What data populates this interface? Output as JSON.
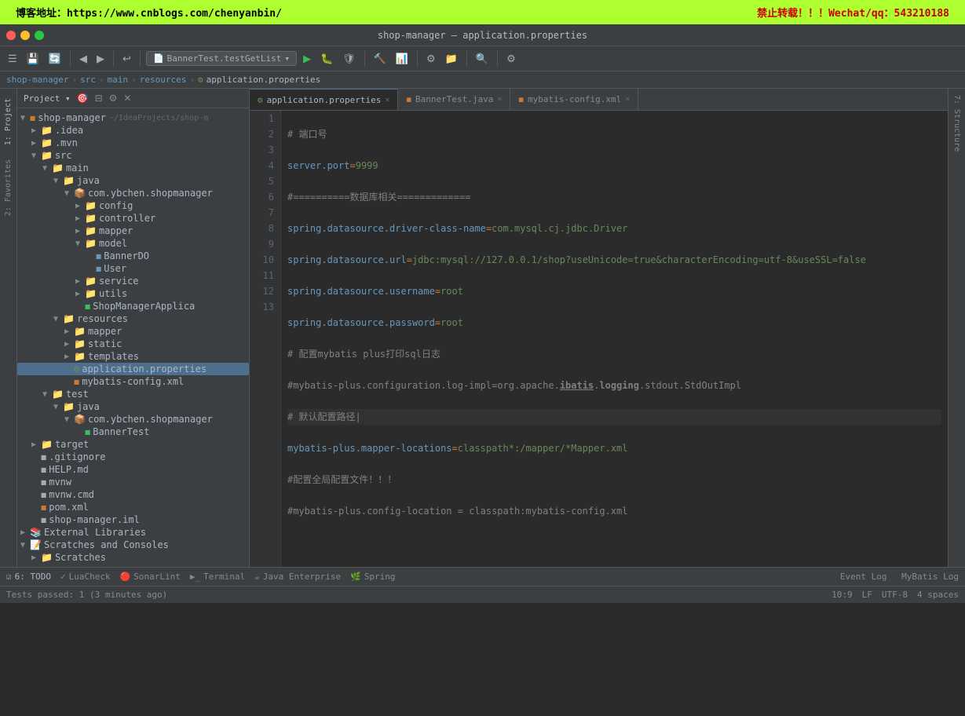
{
  "banner": {
    "left": "博客地址：https://www.cnblogs.com/chenyanbin/",
    "right": "禁止转载！！！Wechat/qq：543210188"
  },
  "titlebar": {
    "title": "shop-manager – application.properties"
  },
  "toolbar": {
    "run_config": "BannerTest.testGetList",
    "run_config_dropdown": "▾"
  },
  "breadcrumb": {
    "items": [
      "shop-manager",
      "src",
      "main",
      "resources",
      "application.properties"
    ]
  },
  "tabs": [
    {
      "label": "application.properties",
      "icon": "props",
      "active": true
    },
    {
      "label": "BannerTest.java",
      "icon": "java",
      "active": false
    },
    {
      "label": "mybatis-config.xml",
      "icon": "xml",
      "active": false
    }
  ],
  "sidebar": {
    "title": "Project",
    "tree": [
      {
        "label": "shop-manager",
        "type": "module",
        "level": 0,
        "expanded": true,
        "suffix": "~/IdeaProjects/shop-m"
      },
      {
        "label": ".idea",
        "type": "folder",
        "level": 1,
        "expanded": false
      },
      {
        "label": ".mvn",
        "type": "folder",
        "level": 1,
        "expanded": false
      },
      {
        "label": "src",
        "type": "folder",
        "level": 1,
        "expanded": true
      },
      {
        "label": "main",
        "type": "folder",
        "level": 2,
        "expanded": true
      },
      {
        "label": "java",
        "type": "folder",
        "level": 3,
        "expanded": true
      },
      {
        "label": "com.ybchen.shopmanager",
        "type": "package",
        "level": 4,
        "expanded": true
      },
      {
        "label": "config",
        "type": "folder",
        "level": 5,
        "expanded": false
      },
      {
        "label": "controller",
        "type": "folder",
        "level": 5,
        "expanded": false
      },
      {
        "label": "mapper",
        "type": "folder",
        "level": 5,
        "expanded": false
      },
      {
        "label": "model",
        "type": "folder",
        "level": 5,
        "expanded": true
      },
      {
        "label": "BannerDO",
        "type": "class",
        "level": 6,
        "expanded": false
      },
      {
        "label": "User",
        "type": "class",
        "level": 6,
        "expanded": false
      },
      {
        "label": "service",
        "type": "folder",
        "level": 5,
        "expanded": false
      },
      {
        "label": "utils",
        "type": "folder",
        "level": 5,
        "expanded": false
      },
      {
        "label": "ShopManagerApplica",
        "type": "appclass",
        "level": 5,
        "expanded": false
      },
      {
        "label": "resources",
        "type": "folder",
        "level": 3,
        "expanded": true
      },
      {
        "label": "mapper",
        "type": "folder",
        "level": 4,
        "expanded": false
      },
      {
        "label": "static",
        "type": "folder",
        "level": 4,
        "expanded": false
      },
      {
        "label": "templates",
        "type": "folder",
        "level": 4,
        "expanded": false
      },
      {
        "label": "application.properties",
        "type": "properties",
        "level": 4,
        "expanded": false,
        "selected": true
      },
      {
        "label": "mybatis-config.xml",
        "type": "xml",
        "level": 4,
        "expanded": false
      },
      {
        "label": "test",
        "type": "folder",
        "level": 2,
        "expanded": true
      },
      {
        "label": "java",
        "type": "folder",
        "level": 3,
        "expanded": true
      },
      {
        "label": "com.ybchen.shopmanager",
        "type": "package",
        "level": 4,
        "expanded": true
      },
      {
        "label": "BannerTest",
        "type": "testclass",
        "level": 5,
        "expanded": false
      },
      {
        "label": "target",
        "type": "folder",
        "level": 1,
        "expanded": false
      },
      {
        "label": ".gitignore",
        "type": "git",
        "level": 1
      },
      {
        "label": "HELP.md",
        "type": "md",
        "level": 1
      },
      {
        "label": "mvnw",
        "type": "file",
        "level": 1
      },
      {
        "label": "mvnw.cmd",
        "type": "file",
        "level": 1
      },
      {
        "label": "pom.xml",
        "type": "xml",
        "level": 1
      },
      {
        "label": "shop-manager.iml",
        "type": "iml",
        "level": 1
      },
      {
        "label": "External Libraries",
        "type": "extlib",
        "level": 0,
        "expanded": false
      },
      {
        "label": "Scratches and Consoles",
        "type": "scratches",
        "level": 0,
        "expanded": true
      },
      {
        "label": "Scratches",
        "type": "folder",
        "level": 1,
        "expanded": false
      }
    ]
  },
  "code_lines": [
    {
      "num": 1,
      "content": "# 端口号",
      "type": "comment"
    },
    {
      "num": 2,
      "content": "server.port=9999",
      "type": "kv",
      "key": "server.port",
      "val": "9999"
    },
    {
      "num": 3,
      "content": "#==========数据库相关=============",
      "type": "comment"
    },
    {
      "num": 4,
      "content": "spring.datasource.driver-class-name=com.mysql.cj.jdbc.Driver",
      "type": "kv",
      "key": "spring.datasource.driver-class-name",
      "val": "com.mysql.cj.jdbc.Driver"
    },
    {
      "num": 5,
      "content": "spring.datasource.url=jdbc:mysql://127.0.0.1/shop?useUnicode=true&characterEncoding=utf-8&useSSL=false",
      "type": "kv",
      "key": "spring.datasource.url",
      "val": "jdbc:mysql://127.0.0.1/shop?useUnicode=true&characterEncoding=utf-8&useSSL=false"
    },
    {
      "num": 6,
      "content": "spring.datasource.username=root",
      "type": "kv",
      "key": "spring.datasource.username",
      "val": "root"
    },
    {
      "num": 7,
      "content": "spring.datasource.password=root",
      "type": "kv",
      "key": "spring.datasource.password",
      "val": "root"
    },
    {
      "num": 8,
      "content": "# 配置mybatis plus打印sql日志",
      "type": "comment"
    },
    {
      "num": 9,
      "content": "#mybatis-plus.configuration.log-impl=org.apache.ibatis.logging.stdout.StdOutImpl",
      "type": "comment_kv"
    },
    {
      "num": 10,
      "content": "# 默认配置路径|",
      "type": "comment",
      "current": true
    },
    {
      "num": 11,
      "content": "mybatis-plus.mapper-locations=classpath*:/mapper/*Mapper.xml",
      "type": "kv",
      "key": "mybatis-plus.mapper-locations",
      "val": "classpath*:/mapper/*Mapper.xml"
    },
    {
      "num": 12,
      "content": "#配置全局配置文件！！！",
      "type": "comment"
    },
    {
      "num": 13,
      "content": "#mybatis-plus.config-location = classpath:mybatis-config.xml",
      "type": "comment"
    }
  ],
  "statusbar": {
    "left": [
      {
        "label": "6: TODO"
      },
      {
        "label": "LuaCheck"
      },
      {
        "label": "SonarLint"
      },
      {
        "label": "Terminal"
      },
      {
        "label": "Java Enterprise"
      },
      {
        "label": "Spring"
      }
    ],
    "right": [
      {
        "label": "Event Log"
      },
      {
        "label": "MyBatis Log"
      }
    ]
  },
  "editor_status": {
    "position": "10:9",
    "lf": "LF",
    "encoding": "UTF-8",
    "indent": "4 spaces"
  },
  "left_vert_tabs": [
    {
      "label": "Project",
      "number": "1"
    },
    {
      "label": "Favorites",
      "number": "2"
    }
  ],
  "right_vert_tabs": [
    {
      "label": "Structure",
      "number": "7"
    }
  ]
}
